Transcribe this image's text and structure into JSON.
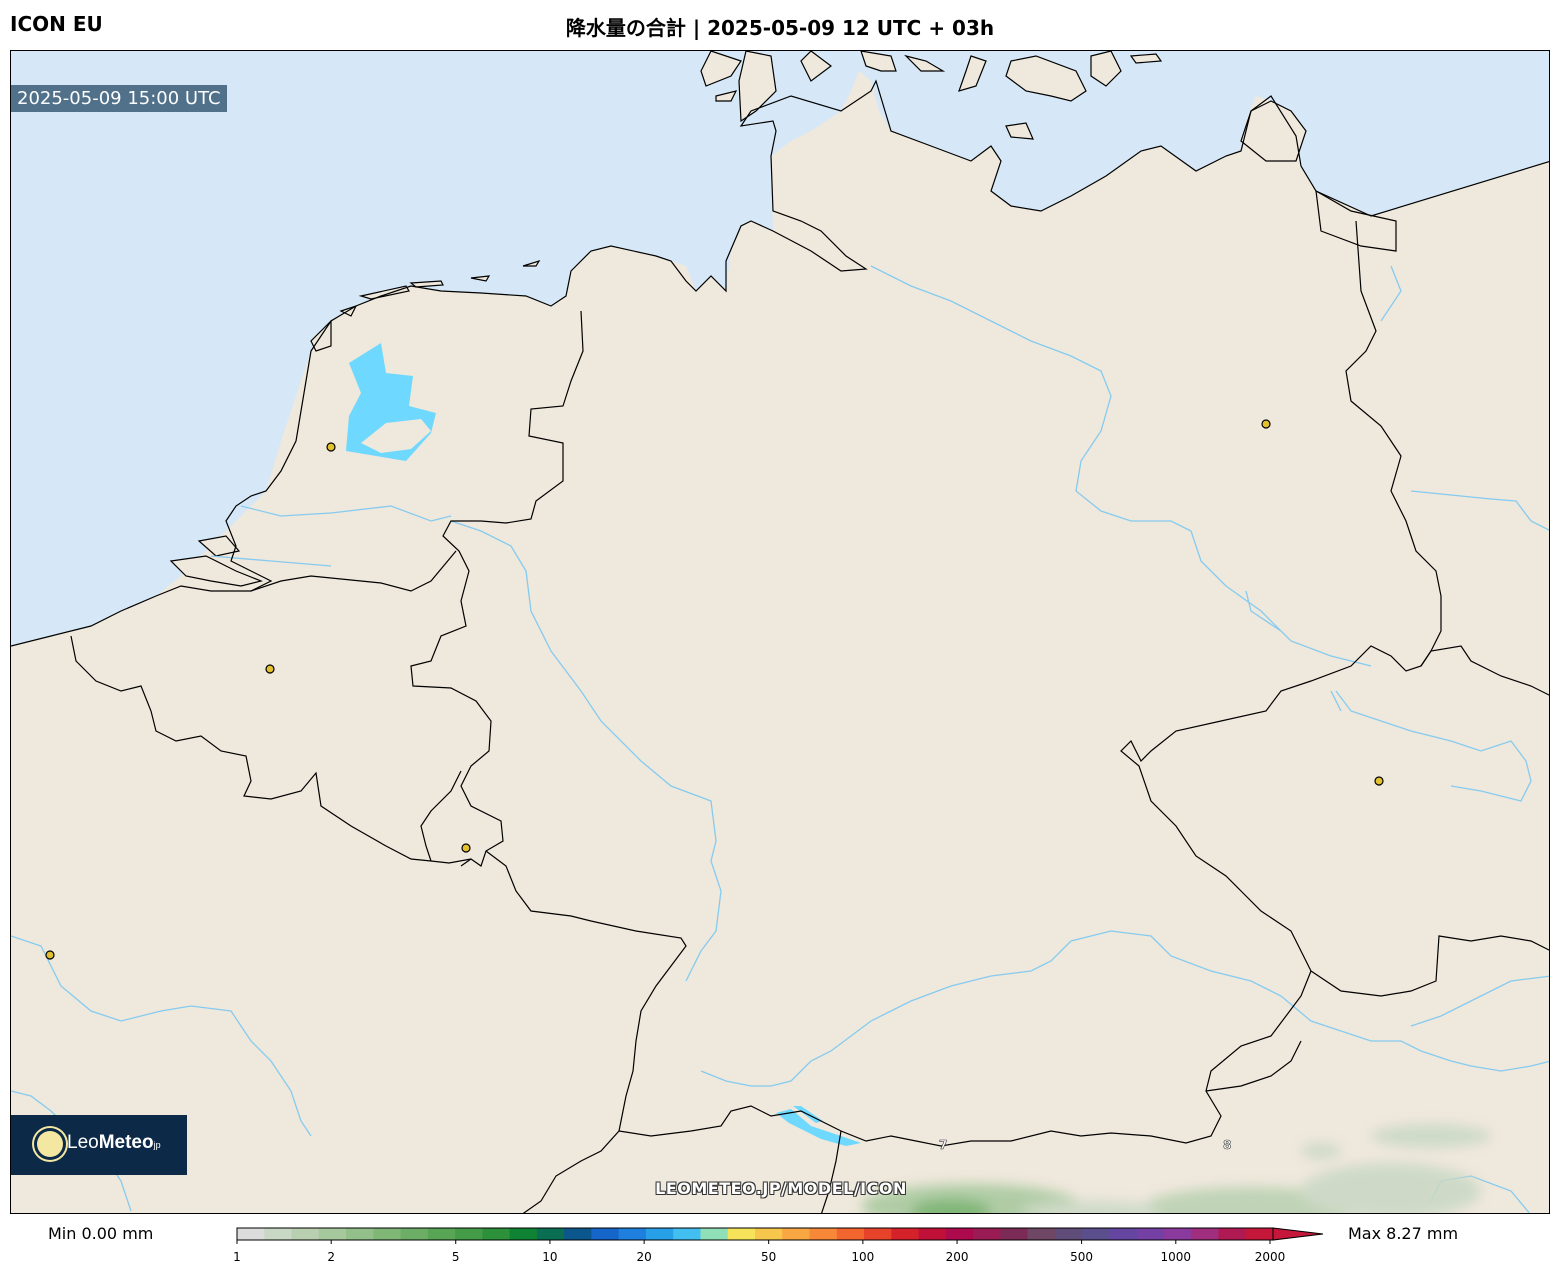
{
  "header": {
    "model": "ICON EU",
    "title": "降水量の合計 | 2025-05-09 12 UTC + 03h"
  },
  "map": {
    "timestamp": "2025-05-09 15:00 UTC",
    "watermark_url": "LEOMETEO.JP/MODEL/ICON",
    "logo": {
      "brand_light": "Leo",
      "brand_bold": "Meteo",
      "suffix": "jp"
    },
    "numbers": [
      "7",
      "8"
    ],
    "colors": {
      "sea": "#d6e8f7",
      "land": "#efe8dc",
      "lake": "#6fd8ff",
      "river": "#85cbf0",
      "border": "#000000",
      "city": "#e2c12f"
    }
  },
  "colorbar": {
    "min_label": "Min 0.00 mm",
    "max_label": "Max 8.27 mm",
    "ticks": [
      "1",
      "2",
      "5",
      "10",
      "20",
      "50",
      "100",
      "200",
      "500",
      "1000",
      "2000"
    ],
    "colors": [
      "#dcdcdc",
      "#c9d8c4",
      "#b8d0b0",
      "#a5c89c",
      "#93c08a",
      "#80b777",
      "#6dae66",
      "#59a556",
      "#449b48",
      "#2d913b",
      "#0f8234",
      "#0a6e52",
      "#0c568e",
      "#1665c8",
      "#1f7fde",
      "#27a0e8",
      "#42bff0",
      "#8fe0b8",
      "#f6e35a",
      "#f7c64c",
      "#f9a742",
      "#f78838",
      "#f2652f",
      "#e7432a",
      "#d5222a",
      "#c01038",
      "#ad0a4e",
      "#9a1c54",
      "#7c2b57",
      "#6f4664",
      "#5f4c78",
      "#5b4e8c",
      "#6446a0",
      "#7440a3",
      "#8a3a9c",
      "#a02e7e",
      "#b01a52",
      "#c4173a"
    ]
  }
}
